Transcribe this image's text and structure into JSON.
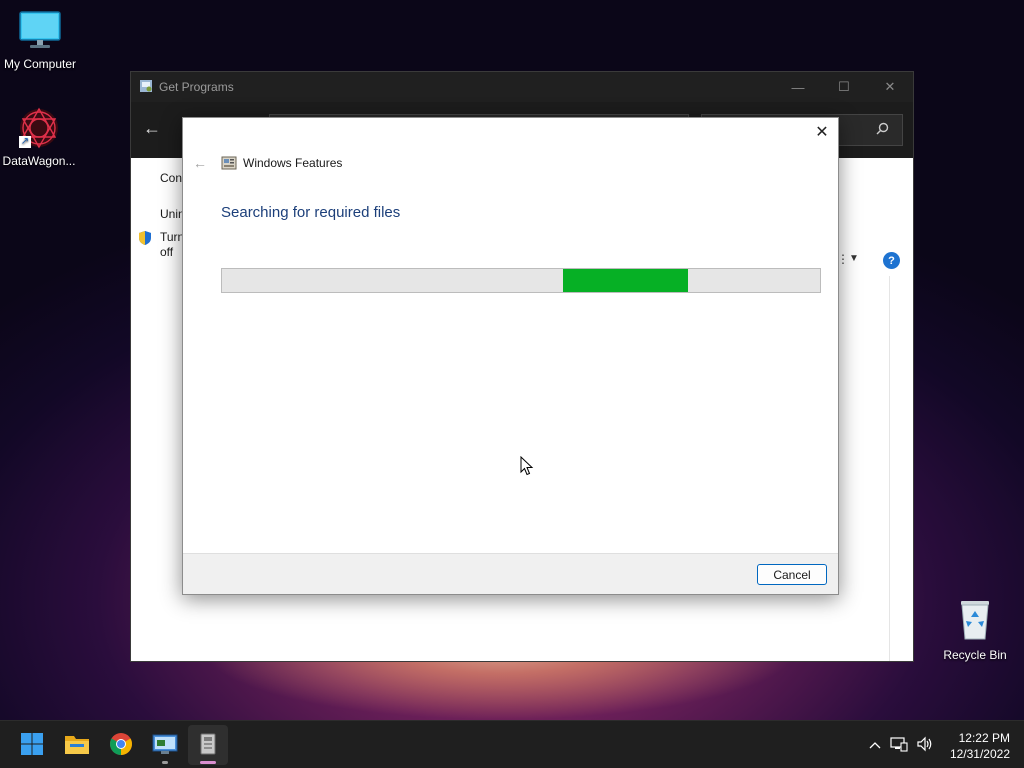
{
  "desktop": {
    "icons": [
      {
        "label": "My Computer",
        "icon": "monitor-icon"
      },
      {
        "label": "DataWagon...",
        "icon": "datawagon-icon"
      },
      {
        "label": "Recycle Bin",
        "icon": "recycle-bin-icon"
      }
    ]
  },
  "background_window": {
    "title": "Get Programs",
    "controls": {
      "minimize": "—",
      "maximize": "☐",
      "close": "✕"
    },
    "nav_back": "←",
    "search_icon": "search-icon",
    "side_links": [
      "Cont",
      "Unin",
      "Turn",
      "off"
    ],
    "help": "?"
  },
  "dialog": {
    "title": "Windows Features",
    "heading": "Searching for required files",
    "progress": {
      "chunk_start": 0.57,
      "chunk_end": 0.78,
      "color": "#06b025"
    },
    "cancel_label": "Cancel",
    "close": "✕",
    "back": "←"
  },
  "taskbar": {
    "apps": [
      "start-icon",
      "file-explorer-icon",
      "chrome-icon",
      "control-panel-icon",
      "windows-features-icon"
    ],
    "tray_chevron": "^",
    "time": "12:22 PM",
    "date": "12/31/2022"
  },
  "colors": {
    "accent": "#0067c0",
    "progress_green": "#06b025",
    "heading_blue": "#1c3f7a",
    "taskbar": "#1f1f1f"
  }
}
